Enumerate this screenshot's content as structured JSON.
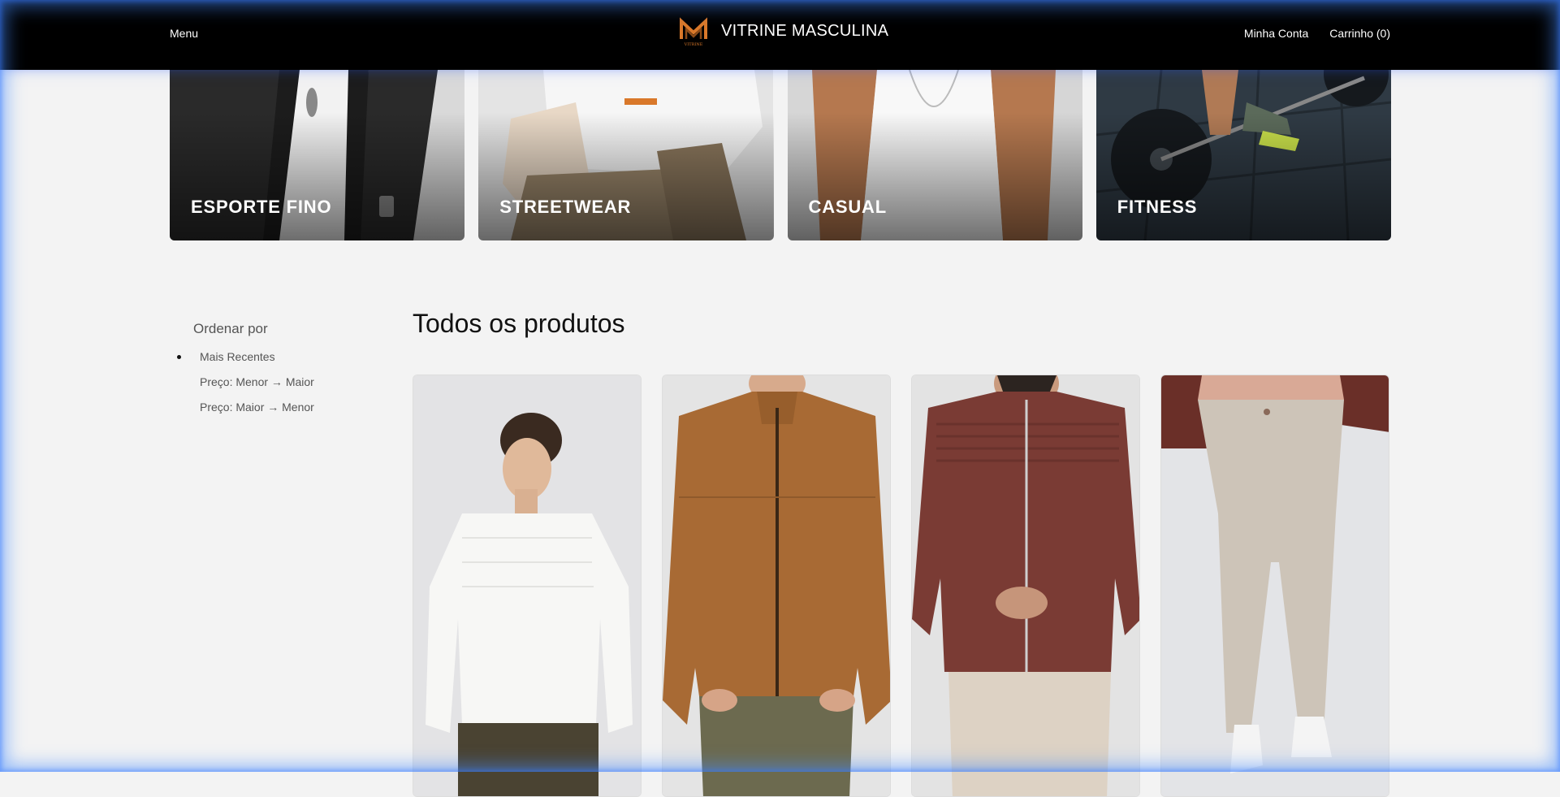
{
  "header": {
    "menu_label": "Menu",
    "brand_name": "VITRINE MASCULINA",
    "logo_text": "VITRINE",
    "account_label": "Minha Conta",
    "cart_label": "Carrinho (0)"
  },
  "categories": [
    {
      "label": "ESPORTE FINO"
    },
    {
      "label": "STREETWEAR"
    },
    {
      "label": "CASUAL"
    },
    {
      "label": "FITNESS"
    }
  ],
  "sidebar": {
    "title": "Ordenar por",
    "options": [
      {
        "label": "Mais Recentes",
        "active": true
      },
      {
        "label": "Preço: Menor → Maior",
        "active": false
      },
      {
        "label": "Preço: Maior → Menor",
        "active": false
      }
    ]
  },
  "products": {
    "title": "Todos os produtos"
  },
  "colors": {
    "header_bg": "#000000",
    "page_bg": "#f3f3f3",
    "logo_orange": "#d9782a"
  }
}
